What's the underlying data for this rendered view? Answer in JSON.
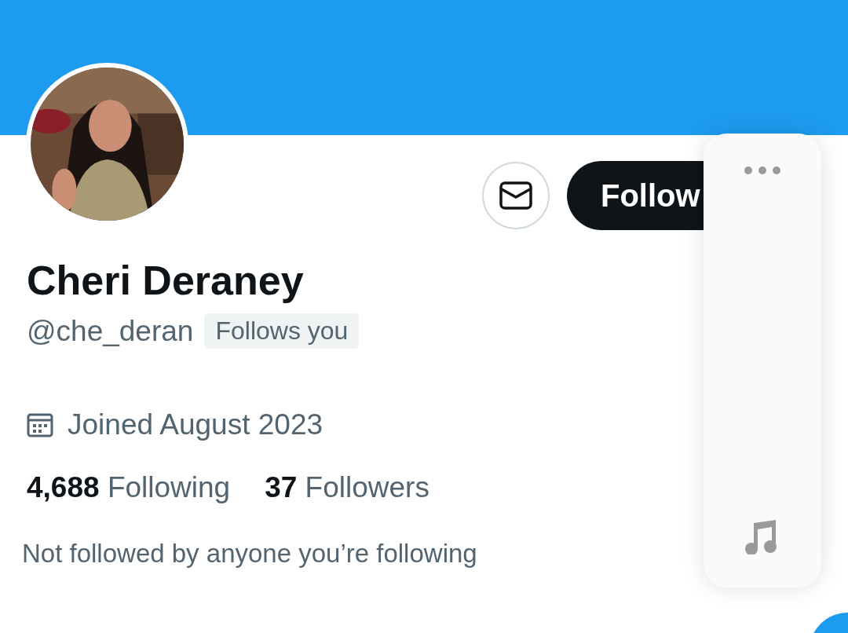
{
  "profile": {
    "name": "Cheri Deraney",
    "handle": "@che_deran",
    "badge": "Follows you",
    "joined": "Joined August 2023",
    "stats": [
      {
        "count": "4,688",
        "label": "Following"
      },
      {
        "count": "37",
        "label": "Followers"
      }
    ],
    "mutuals": "Not followed by anyone you’re following"
  },
  "actions": {
    "follow": "Follow"
  }
}
